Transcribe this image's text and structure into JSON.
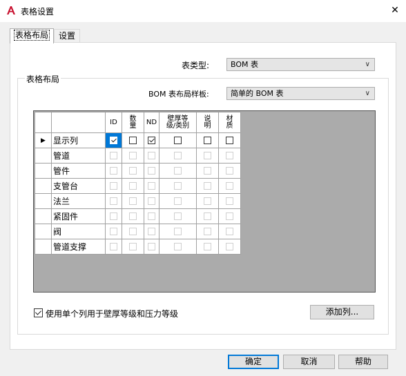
{
  "window": {
    "title": "表格设置",
    "close_glyph": "✕"
  },
  "tabs": [
    {
      "label": "表格布局"
    },
    {
      "label": "设置"
    }
  ],
  "table_type": {
    "label": "表类型:",
    "value": "BOM 表"
  },
  "group": {
    "title": "表格布局",
    "template_label": "BOM 表布局样板:",
    "template_value": "简单的 BOM 表"
  },
  "grid": {
    "columns": [
      "ID",
      "数量",
      "ND",
      "壁厚等级/类别",
      "说明",
      "材质"
    ],
    "column_display": [
      "ID",
      "数\n量",
      "ND",
      "壁厚等\n级/类别",
      "说\n明",
      "材\n质"
    ],
    "current_row_marker": "▶",
    "rows": [
      {
        "name": "显示列",
        "checks": [
          true,
          false,
          true,
          false,
          false,
          false
        ],
        "enabled": true
      },
      {
        "name": "管道",
        "checks": [
          false,
          false,
          false,
          false,
          false,
          false
        ],
        "enabled": false
      },
      {
        "name": "管件",
        "checks": [
          false,
          false,
          false,
          false,
          false,
          false
        ],
        "enabled": false
      },
      {
        "name": "支管台",
        "checks": [
          false,
          false,
          false,
          false,
          false,
          false
        ],
        "enabled": false
      },
      {
        "name": "法兰",
        "checks": [
          false,
          false,
          false,
          false,
          false,
          false
        ],
        "enabled": false
      },
      {
        "name": "紧固件",
        "checks": [
          false,
          false,
          false,
          false,
          false,
          false
        ],
        "enabled": false
      },
      {
        "name": "阀",
        "checks": [
          false,
          false,
          false,
          false,
          false,
          false
        ],
        "enabled": false
      },
      {
        "name": "管道支撑",
        "checks": [
          false,
          false,
          false,
          false,
          false,
          false
        ],
        "enabled": false
      }
    ]
  },
  "single_column_option": {
    "label": "使用单个列用于壁厚等级和压力等级",
    "checked": true
  },
  "buttons": {
    "add_column": "添加列...",
    "ok": "确定",
    "cancel": "取消",
    "help": "帮助"
  },
  "colors": {
    "accent": "#0078d7",
    "grid_bg": "#ababab",
    "autocad_red": "#c8102e"
  }
}
